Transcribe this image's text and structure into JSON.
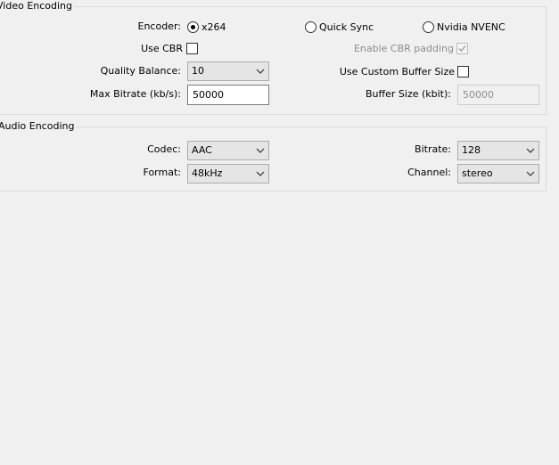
{
  "video": {
    "title": "Video Encoding",
    "encoder_label": "Encoder:",
    "encoder_options": [
      "x264",
      "Quick Sync",
      "Nvidia NVENC"
    ],
    "use_cbr_label": "Use CBR",
    "enable_cbr_padding_label": "Enable CBR padding",
    "quality_balance_label": "Quality Balance:",
    "quality_balance_value": "10",
    "use_custom_buffer_label": "Use Custom Buffer Size",
    "max_bitrate_label": "Max Bitrate (kb/s):",
    "max_bitrate_value": "50000",
    "buffer_size_label": "Buffer Size (kbit):",
    "buffer_size_value": "50000"
  },
  "audio": {
    "title": "Audio Encoding",
    "codec_label": "Codec:",
    "codec_value": "AAC",
    "bitrate_label": "Bitrate:",
    "bitrate_value": "128",
    "format_label": "Format:",
    "format_value": "48kHz",
    "channel_label": "Channel:",
    "channel_value": "stereo"
  }
}
